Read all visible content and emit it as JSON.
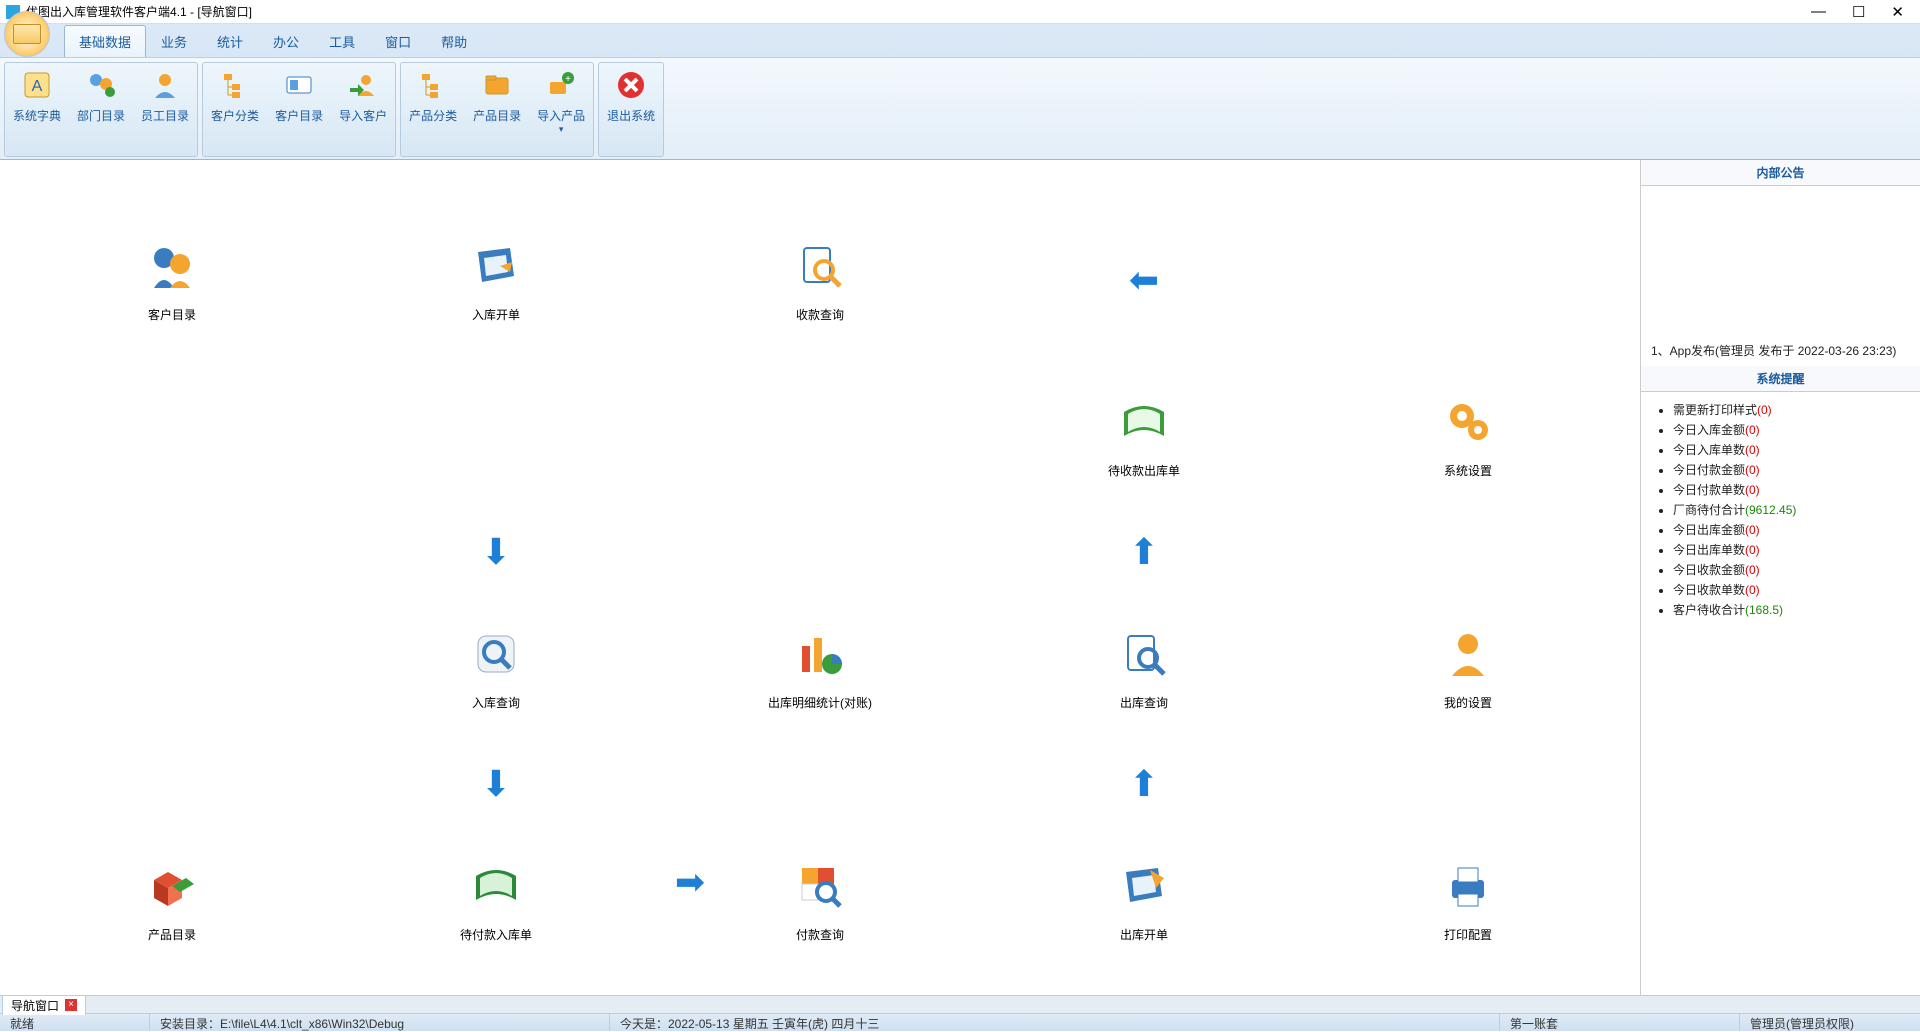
{
  "window": {
    "title": "优图出入库管理软件客户端4.1 - [导航窗口]"
  },
  "tabs": {
    "t0": "基础数据",
    "t1": "业务",
    "t2": "统计",
    "t3": "办公",
    "t4": "工具",
    "t5": "窗口",
    "t6": "帮助"
  },
  "ribbon": {
    "g0": {
      "b0": "系统字典",
      "b1": "部门目录",
      "b2": "员工目录"
    },
    "g1": {
      "b0": "客户分类",
      "b1": "客户目录",
      "b2": "导入客户"
    },
    "g2": {
      "b0": "产品分类",
      "b1": "产品目录",
      "b2": "导入产品"
    },
    "g3": {
      "b0": "退出系统"
    }
  },
  "nav": {
    "r0c0": "客户目录",
    "r0c1": "入库开单",
    "r0c2": "收款查询",
    "r0c4": "待收款出库单",
    "r0c5": "系统设置",
    "r1c1": "入库查询",
    "r1c2": "出库明细统计(对账)",
    "r1c4": "出库查询",
    "r1c5": "我的设置",
    "r2c0": "产品目录",
    "r2c1": "待付款入库单",
    "r2c2": "付款查询",
    "r2c4": "出库开单",
    "r2c5": "打印配置"
  },
  "doctab": {
    "label": "导航窗口"
  },
  "right": {
    "announce_title": "内部公告",
    "announce_item": "1、App发布(管理员 发布于 2022-03-26 23:23)",
    "reminder_title": "系统提醒",
    "items": {
      "i0": {
        "label": "需更新打印样式",
        "val": "(0)",
        "cls": "rp-val"
      },
      "i1": {
        "label": "今日入库金额",
        "val": "(0)",
        "cls": "rp-val"
      },
      "i2": {
        "label": "今日入库单数",
        "val": "(0)",
        "cls": "rp-val"
      },
      "i3": {
        "label": "今日付款金额",
        "val": "(0)",
        "cls": "rp-val"
      },
      "i4": {
        "label": "今日付款单数",
        "val": "(0)",
        "cls": "rp-val"
      },
      "i5": {
        "label": "厂商待付合计",
        "val": "(9612.45)",
        "cls": "rp-val green"
      },
      "i6": {
        "label": "今日出库金额",
        "val": "(0)",
        "cls": "rp-val"
      },
      "i7": {
        "label": "今日出库单数",
        "val": "(0)",
        "cls": "rp-val"
      },
      "i8": {
        "label": "今日收款金额",
        "val": "(0)",
        "cls": "rp-val"
      },
      "i9": {
        "label": "今日收款单数",
        "val": "(0)",
        "cls": "rp-val"
      },
      "i10": {
        "label": "客户待收合计",
        "val": "(168.5)",
        "cls": "rp-val green"
      }
    }
  },
  "status": {
    "s0": "就绪",
    "s1": "安装目录：E:\\file\\L4\\4.1\\clt_x86\\Win32\\Debug",
    "s2": "今天是：2022-05-13 星期五 壬寅年(虎) 四月十三",
    "s3": "第一账套",
    "s4": "管理员(管理员权限)"
  }
}
